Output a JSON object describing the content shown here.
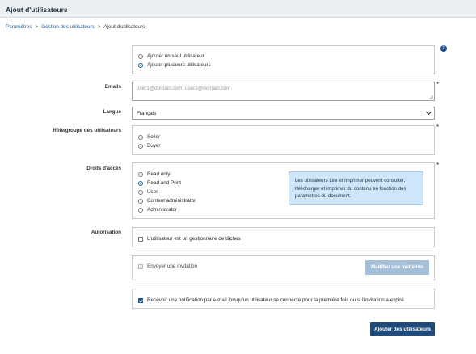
{
  "header": {
    "title": "Ajout d'utilisateurs"
  },
  "breadcrumb": {
    "items": [
      "Paramètres",
      "Gestion des utilisateurs",
      "Ajout d'utilisateurs"
    ],
    "separator": ">"
  },
  "help": {
    "icon": "help-circle-icon",
    "glyph": "?"
  },
  "mode": {
    "options": [
      "Ajouter un seul utilisateur",
      "Ajouter plusieurs utilisateurs"
    ],
    "selected": "Ajouter plusieurs utilisateurs"
  },
  "emails": {
    "label": "Emails",
    "placeholder": "user1@domain.com; user2@domain.com",
    "value": "",
    "required_mark": "*"
  },
  "language": {
    "label": "Langue",
    "value": "Français"
  },
  "roles": {
    "label": "Rôle/groupe des utilisateurs",
    "required_mark": "*",
    "options": [
      "Seller",
      "Buyer"
    ],
    "selected": null
  },
  "rights": {
    "label": "Droits d'accès",
    "required_mark": "*",
    "options": [
      "Read only",
      "Read and Print",
      "User",
      "Content administrator",
      "Administrator"
    ],
    "selected": "Read and Print",
    "info": "Les utilisateurs Lire et Imprimer peuvent consulter, télécharger et imprimer du contenu en fonction des paramètres du document."
  },
  "authorization": {
    "label": "Autorisation",
    "checkbox_label": "L'utilisateur est un gestionnaire de tâches",
    "checked": false
  },
  "invitation": {
    "checkbox_label": "Envoyer une invitation",
    "checked": false,
    "disabled": true,
    "edit_button": "Modifier une invitation"
  },
  "notification": {
    "checkbox_label": "Recevoir une notification par e-mail lorsqu'un utilisateur se connecte pour la première fois ou si l'invitation a expiré",
    "checked": true
  },
  "submit": {
    "label": "Ajouter des utilisateurs"
  },
  "colors": {
    "primary": "#1f4a7a",
    "link": "#1d5c99",
    "info_bg": "#cfe5fa",
    "disabled_button": "#a6bfd9"
  }
}
